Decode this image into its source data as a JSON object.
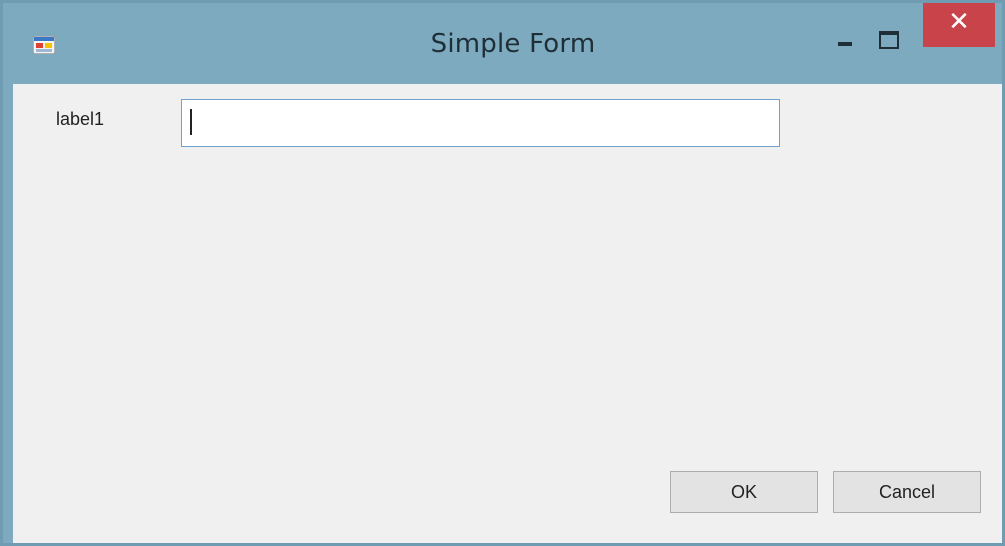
{
  "window": {
    "title": "Simple Form",
    "icon": "app-form-icon",
    "controls": {
      "minimize_glyph": "–",
      "maximize_glyph": "□",
      "close_glyph": "✕"
    },
    "colors": {
      "titlebar": "#7daabf",
      "close_button": "#c8434a",
      "client_background": "#f0f0f0"
    }
  },
  "form": {
    "label": "label1",
    "textbox_value": "",
    "ok_label": "OK",
    "cancel_label": "Cancel"
  }
}
